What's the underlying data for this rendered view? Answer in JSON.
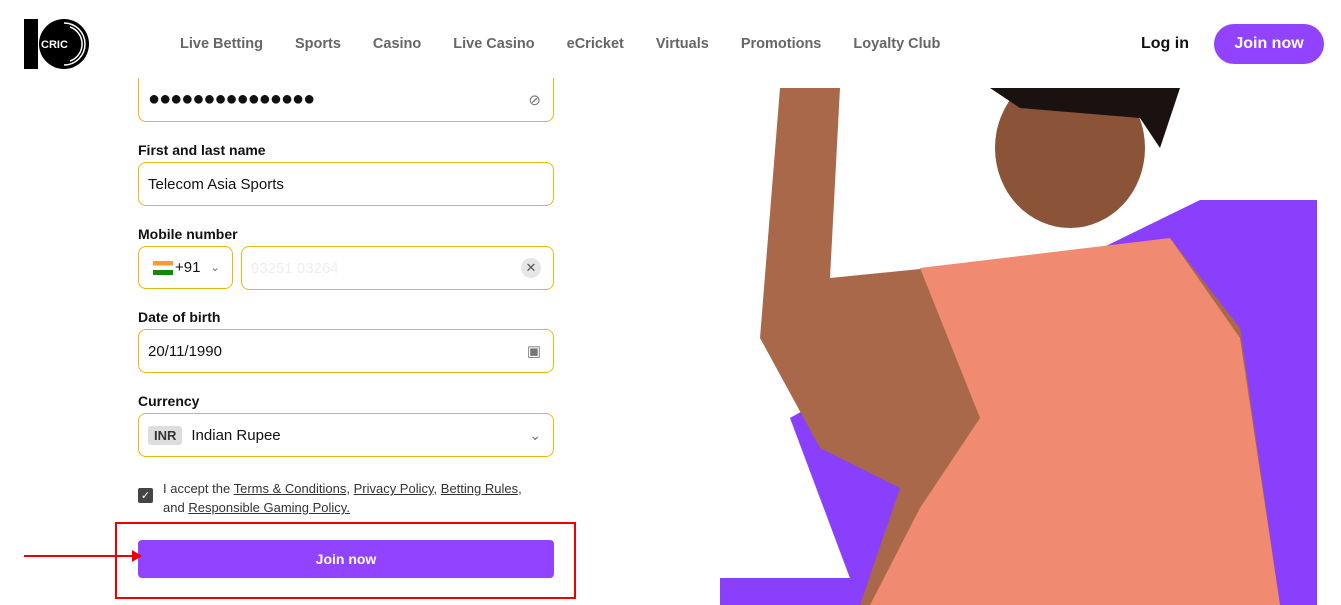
{
  "header": {
    "logo_text": "CRIC",
    "nav": [
      "Live Betting",
      "Sports",
      "Casino",
      "Live Casino",
      "eCricket",
      "Virtuals",
      "Promotions",
      "Loyalty Club"
    ],
    "login": "Log in",
    "join": "Join now"
  },
  "form": {
    "password_value": "●●●●●●●●●●●●●●●",
    "name_label": "First and last name",
    "name_value": "Telecom Asia Sports",
    "mobile_label": "Mobile number",
    "country_code": "+91",
    "mobile_value": "93251 03264",
    "dob_label": "Date of birth",
    "dob_value": "20/11/1990",
    "currency_label": "Currency",
    "currency_code": "INR",
    "currency_name": "Indian Rupee",
    "terms": {
      "prefix": "I accept the",
      "tc": "Terms & Conditions",
      "sep1": ",",
      "pp": "Privacy Policy",
      "sep2": ",",
      "br": "Betting Rules",
      "mid": ", and",
      "rg": "Responsible Gaming Policy."
    },
    "submit": "Join now"
  },
  "colors": {
    "brand": "#9143ff",
    "field_border": "#e8b90f",
    "annotation": "#e00000"
  }
}
